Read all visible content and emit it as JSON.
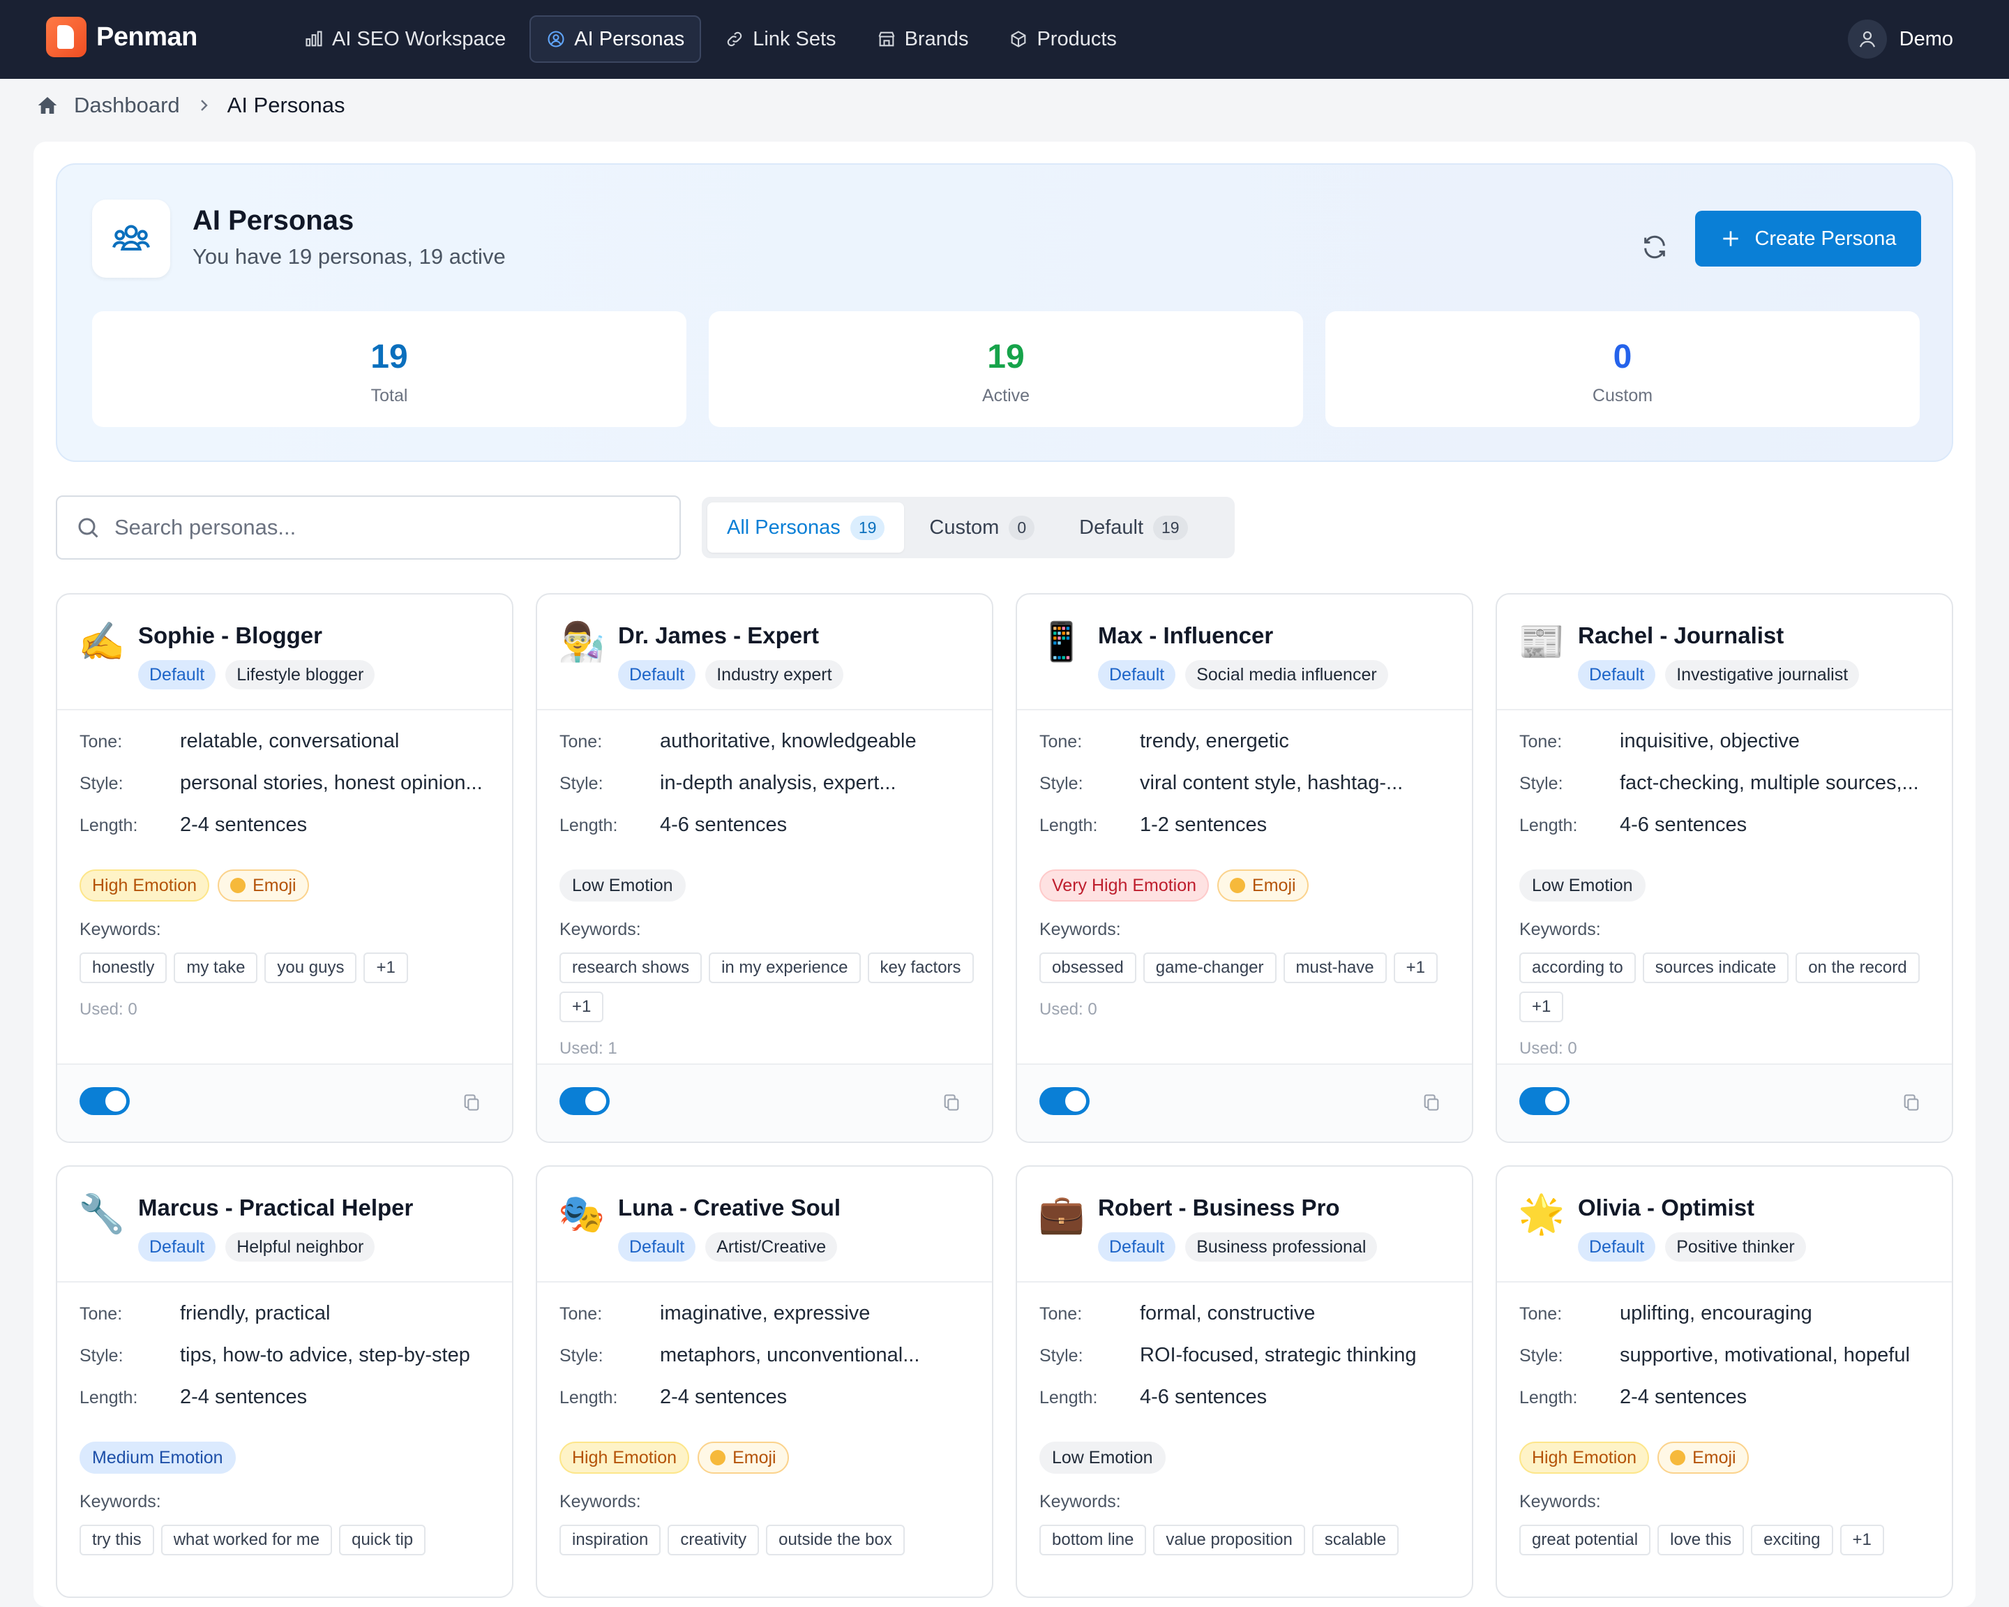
{
  "app": {
    "name": "Penman"
  },
  "nav": {
    "items": [
      {
        "label": "AI SEO Workspace",
        "icon": "bar-chart-icon"
      },
      {
        "label": "AI Personas",
        "icon": "user-circle-icon",
        "active": true
      },
      {
        "label": "Link Sets",
        "icon": "link-icon"
      },
      {
        "label": "Brands",
        "icon": "store-icon"
      },
      {
        "label": "Products",
        "icon": "box-icon"
      }
    ],
    "user": "Demo"
  },
  "breadcrumb": {
    "home": "Dashboard",
    "current": "AI Personas"
  },
  "header": {
    "title": "AI Personas",
    "subtitle": "You have 19 personas, 19 active",
    "create_label": "Create Persona"
  },
  "stats": [
    {
      "value": "19",
      "label": "Total",
      "color": "#0a6fbd"
    },
    {
      "value": "19",
      "label": "Active",
      "color": "#16a34a"
    },
    {
      "value": "0",
      "label": "Custom",
      "color": "#2563eb"
    }
  ],
  "search": {
    "placeholder": "Search personas..."
  },
  "tabs": [
    {
      "label": "All Personas",
      "count": "19"
    },
    {
      "label": "Custom",
      "count": "0"
    },
    {
      "label": "Default",
      "count": "19"
    }
  ],
  "labels": {
    "tone": "Tone:",
    "style": "Style:",
    "length": "Length:",
    "keywords": "Keywords:"
  },
  "personas": [
    {
      "emoji": "✍️",
      "name": "Sophie - Blogger",
      "badge": "Default",
      "role": "Lifestyle blogger",
      "tone": "relatable, conversational",
      "style": "personal stories, honest opinion...",
      "length": "2-4 sentences",
      "emotion": "High Emotion",
      "emotion_kind": "high",
      "emoji_pill": "Emoji",
      "keywords": [
        "honestly",
        "my take",
        "you guys",
        "+1"
      ],
      "used": "Used: 0"
    },
    {
      "emoji": "👨‍🔬",
      "name": "Dr. James - Expert",
      "badge": "Default",
      "role": "Industry expert",
      "tone": "authoritative, knowledgeable",
      "style": "in-depth analysis, expert...",
      "length": "4-6 sentences",
      "emotion": "Low Emotion",
      "emotion_kind": "low",
      "emoji_pill": "",
      "keywords": [
        "research shows",
        "in my experience",
        "key factors",
        "+1"
      ],
      "used": "Used: 1"
    },
    {
      "emoji": "📱",
      "name": "Max - Influencer",
      "badge": "Default",
      "role": "Social media influencer",
      "tone": "trendy, energetic",
      "style": "viral content style, hashtag-...",
      "length": "1-2 sentences",
      "emotion": "Very High Emotion",
      "emotion_kind": "vhigh",
      "emoji_pill": "Emoji",
      "keywords": [
        "obsessed",
        "game-changer",
        "must-have",
        "+1"
      ],
      "used": "Used: 0"
    },
    {
      "emoji": "📰",
      "name": "Rachel - Journalist",
      "badge": "Default",
      "role": "Investigative journalist",
      "tone": "inquisitive, objective",
      "style": "fact-checking, multiple sources,...",
      "length": "4-6 sentences",
      "emotion": "Low Emotion",
      "emotion_kind": "low",
      "emoji_pill": "",
      "keywords": [
        "according to",
        "sources indicate",
        "on the record",
        "+1"
      ],
      "used": "Used: 0"
    },
    {
      "emoji": "🔧",
      "name": "Marcus - Practical Helper",
      "badge": "Default",
      "role": "Helpful neighbor",
      "tone": "friendly, practical",
      "style": "tips, how-to advice, step-by-step",
      "length": "2-4 sentences",
      "emotion": "Medium Emotion",
      "emotion_kind": "med",
      "emoji_pill": "",
      "keywords": [
        "try this",
        "what worked for me",
        "quick tip"
      ],
      "used": ""
    },
    {
      "emoji": "🎭",
      "name": "Luna - Creative Soul",
      "badge": "Default",
      "role": "Artist/Creative",
      "tone": "imaginative, expressive",
      "style": "metaphors, unconventional...",
      "length": "2-4 sentences",
      "emotion": "High Emotion",
      "emotion_kind": "high",
      "emoji_pill": "Emoji",
      "keywords": [
        "inspiration",
        "creativity",
        "outside the box"
      ],
      "used": ""
    },
    {
      "emoji": "💼",
      "name": "Robert - Business Pro",
      "badge": "Default",
      "role": "Business professional",
      "tone": "formal, constructive",
      "style": "ROI-focused, strategic thinking",
      "length": "4-6 sentences",
      "emotion": "Low Emotion",
      "emotion_kind": "low",
      "emoji_pill": "",
      "keywords": [
        "bottom line",
        "value proposition",
        "scalable"
      ],
      "used": ""
    },
    {
      "emoji": "🌟",
      "name": "Olivia - Optimist",
      "badge": "Default",
      "role": "Positive thinker",
      "tone": "uplifting, encouraging",
      "style": "supportive, motivational, hopeful",
      "length": "2-4 sentences",
      "emotion": "High Emotion",
      "emotion_kind": "high",
      "emoji_pill": "Emoji",
      "keywords": [
        "great potential",
        "love this",
        "exciting",
        "+1"
      ],
      "used": ""
    }
  ]
}
